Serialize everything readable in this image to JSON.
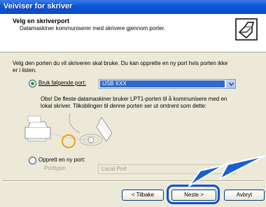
{
  "window": {
    "title": "Veiviser for skriver"
  },
  "header": {
    "title": "Velg en skriverport",
    "subtitle": "Datamaskiner kommuniserer med skrivere gjennom porter."
  },
  "body": {
    "intro_line1": "Velg den porten du vil skriveren skal bruke. Du kan opprette en ny port hvis porten ikke",
    "intro_line2": "er i listen.",
    "use_port_label": "Bruk følgende port:",
    "use_port_selected": true,
    "port_value": "USB XXX",
    "note_line1": "Obs! De fleste datamaskiner bruker LPT1-porten til å kommunisere med en",
    "note_line2": "lokal skriver. Tilkoblingen til denne porten ser ut omtrent som dette:",
    "new_port_label": "Opprett en ny port:",
    "new_port_selected": false,
    "port_type_label": "Porttype:",
    "port_type_value": "Local Port"
  },
  "buttons": {
    "back": "< Tilbake",
    "next": "Neste >",
    "cancel": "Avbryt"
  },
  "colors": {
    "title_bar": "#0a56d6",
    "selection": "#316ac5",
    "highlight": "#0b52d8",
    "arrow": "#1a5fd0"
  }
}
